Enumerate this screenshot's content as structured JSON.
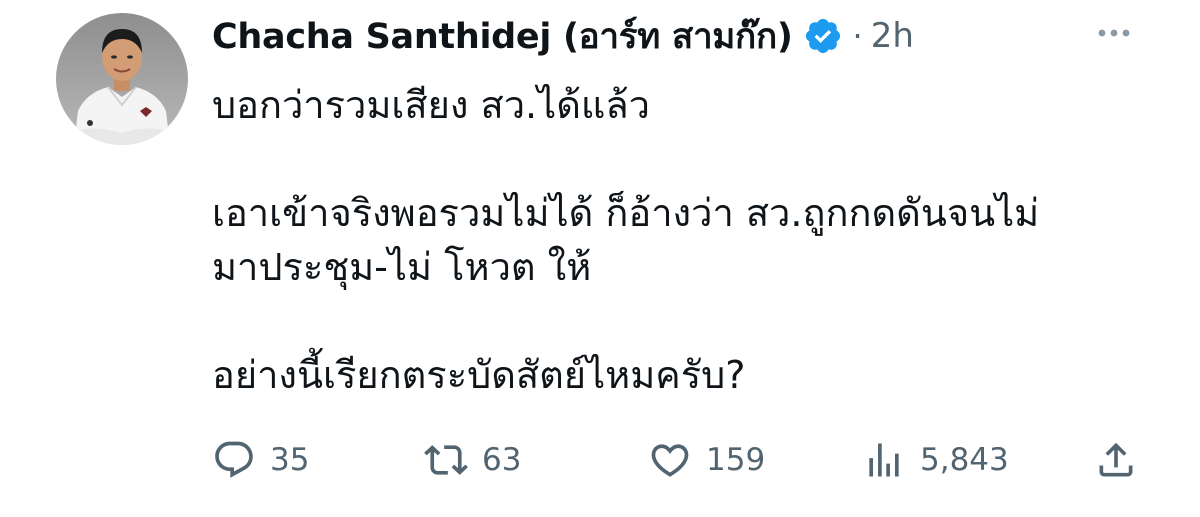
{
  "author": {
    "display_name": "Chacha Santhidej (อาร์ท สามก๊ก)",
    "separator": "·",
    "time": "2h",
    "verified": true
  },
  "tweet": {
    "lines": [
      "บอกว่ารวมเสียง สว.ได้แล้ว",
      "",
      "เอาเข้าจริงพอรวมไม่ได้ ก็อ้างว่า สว.ถูกกดดันจนไม่",
      "มาประชุม-ไม่ โหวต ให้",
      "",
      "อย่างนี้เรียกตระบัดสัตย์ไหมครับ?"
    ]
  },
  "actions": {
    "replies": "35",
    "retweets": "63",
    "likes": "159",
    "views": "5,843"
  },
  "icons": {
    "reply": "comment-bubble-icon",
    "retweet": "retweet-arrows-icon",
    "like": "heart-icon",
    "views": "bar-chart-icon",
    "share": "share-upload-icon",
    "more": "more-dots-icon",
    "verified": "verified-badge-icon"
  },
  "colors": {
    "text": "#0f1419",
    "muted": "#536471",
    "verified_blue": "#1d9bf0"
  }
}
